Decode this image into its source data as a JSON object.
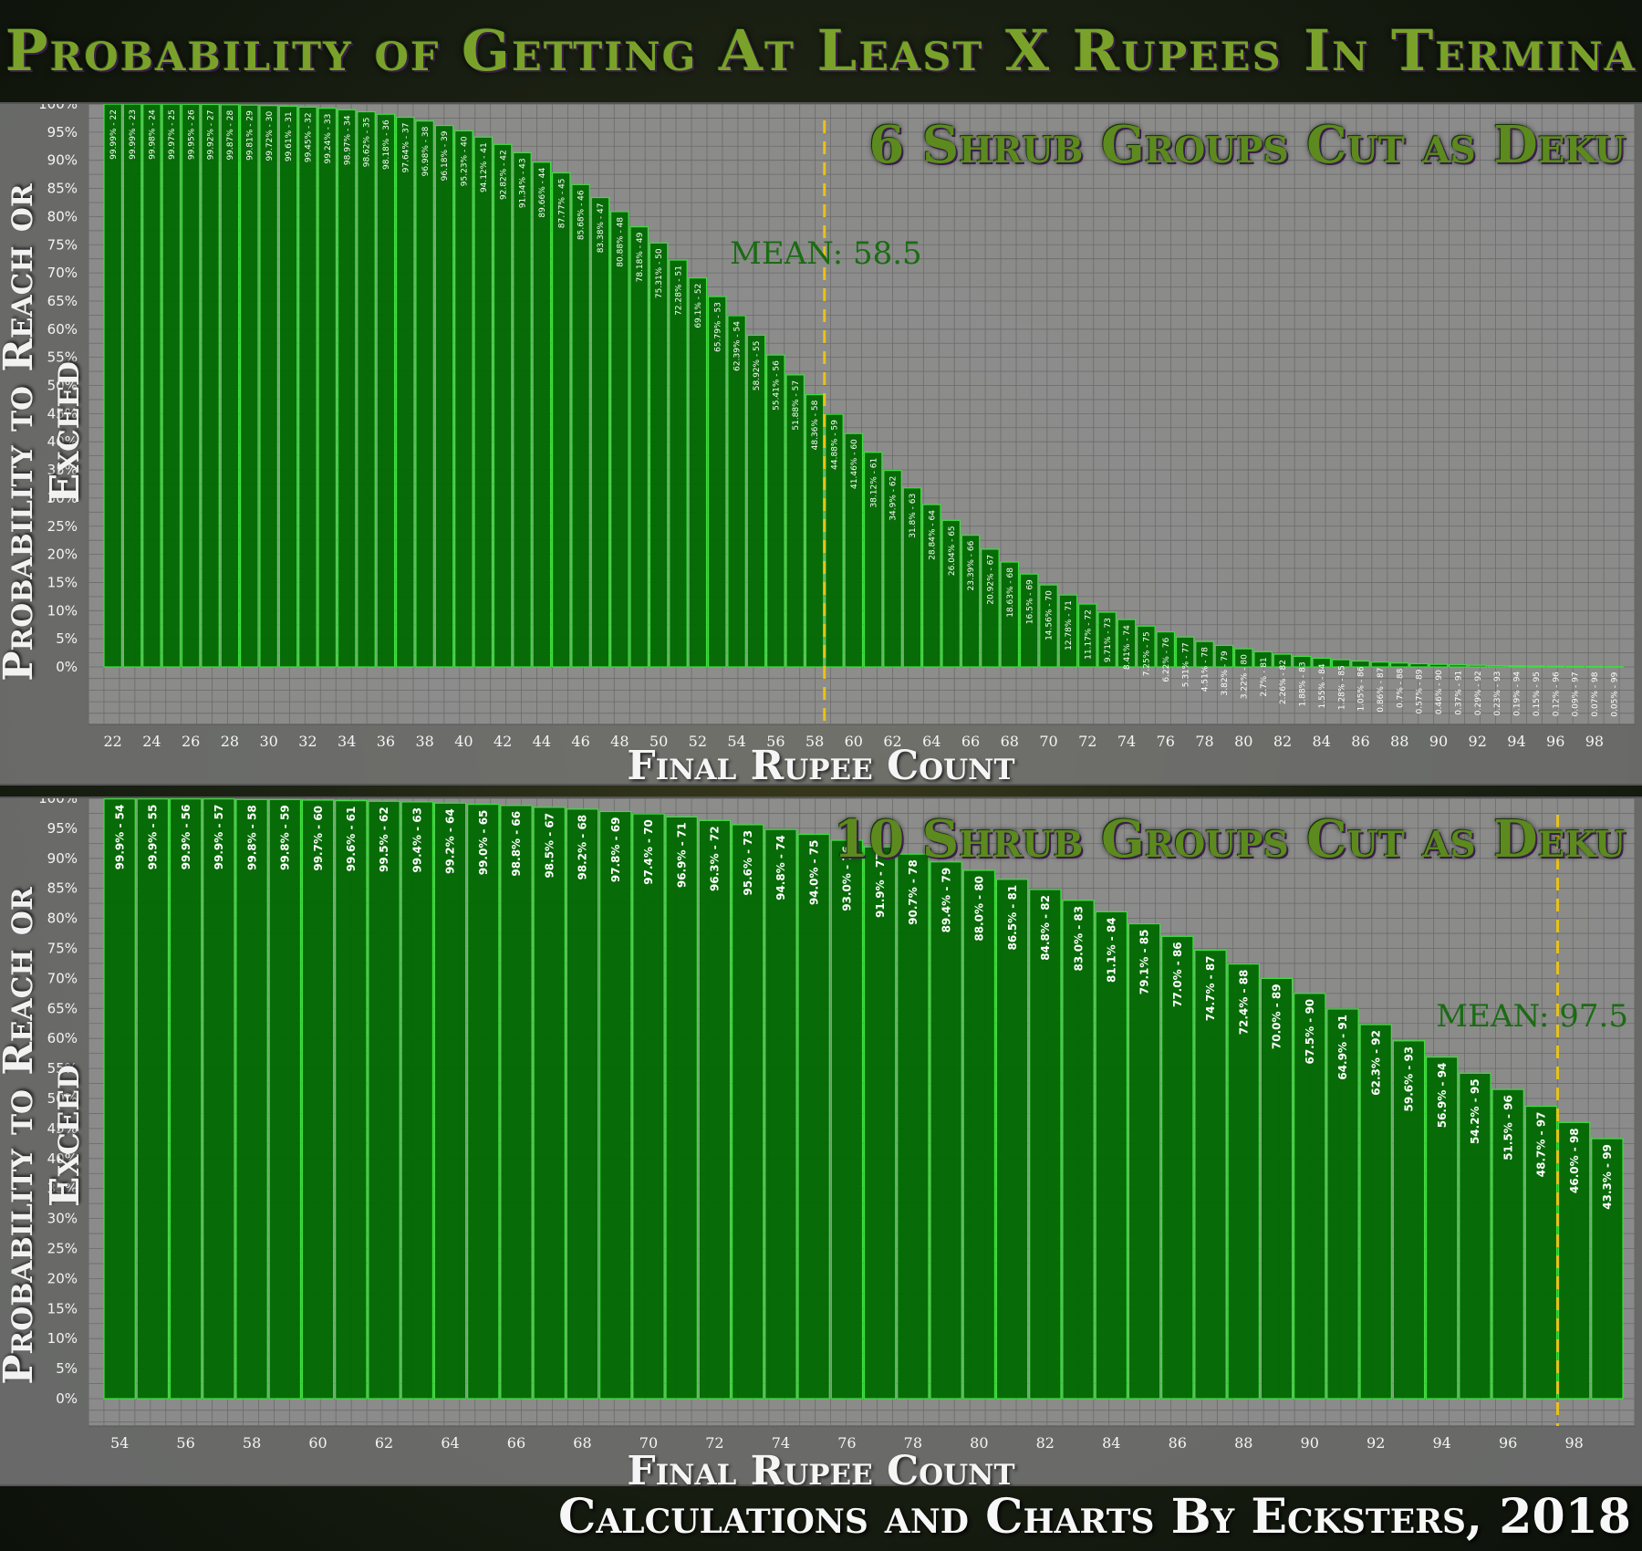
{
  "title": "Probability of Getting At Least X Rupees In Termina",
  "credit": "Calculations and Charts By Ecksters, 2018",
  "chart_data": [
    {
      "type": "bar",
      "title": "6 Shrub Groups Cut as Deku",
      "xlabel": "Final Rupee Count",
      "ylabel": "Probability to Reach or Exceed",
      "ylim": [
        0,
        100
      ],
      "y_ticks": [
        "0%",
        "5%",
        "10%",
        "15%",
        "20%",
        "25%",
        "30%",
        "35%",
        "40%",
        "45%",
        "50%",
        "55%",
        "60%",
        "65%",
        "70%",
        "75%",
        "80%",
        "85%",
        "90%",
        "95%",
        "100%"
      ],
      "x_ticks": [
        "22",
        "24",
        "26",
        "28",
        "30",
        "32",
        "34",
        "36",
        "38",
        "40",
        "42",
        "44",
        "46",
        "48",
        "50",
        "52",
        "54",
        "56",
        "58",
        "60",
        "62",
        "64",
        "66",
        "68",
        "70",
        "72",
        "74",
        "76",
        "78",
        "80",
        "82",
        "84",
        "86",
        "88",
        "90",
        "92",
        "94",
        "96",
        "98"
      ],
      "mean": 58.5,
      "mean_label": "MEAN: 58.5",
      "grid": true,
      "categories": [
        22,
        23,
        24,
        25,
        26,
        27,
        28,
        29,
        30,
        31,
        32,
        33,
        34,
        35,
        36,
        37,
        38,
        39,
        40,
        41,
        42,
        43,
        44,
        45,
        46,
        47,
        48,
        49,
        50,
        51,
        52,
        53,
        54,
        55,
        56,
        57,
        58,
        59,
        60,
        61,
        62,
        63,
        64,
        65,
        66,
        67,
        68,
        69,
        70,
        71,
        72,
        73,
        74,
        75,
        76,
        77,
        78,
        79,
        80,
        81,
        82,
        83,
        84,
        85,
        86,
        87,
        88,
        89,
        90,
        91,
        92,
        93,
        94,
        95,
        96,
        97,
        98,
        99
      ],
      "values": [
        99.99,
        99.99,
        99.98,
        99.97,
        99.95,
        99.92,
        99.87,
        99.81,
        99.72,
        99.61,
        99.45,
        99.24,
        98.97,
        98.62,
        98.18,
        97.64,
        96.98,
        96.18,
        95.23,
        94.12,
        92.82,
        91.34,
        89.66,
        87.77,
        85.68,
        83.38,
        80.88,
        78.18,
        75.31,
        72.28,
        69.1,
        65.79,
        62.39,
        58.92,
        55.41,
        51.88,
        48.36,
        44.88,
        41.46,
        38.12,
        34.9,
        31.8,
        28.84,
        26.04,
        23.39,
        20.92,
        18.63,
        16.5,
        14.56,
        12.78,
        11.17,
        9.71,
        8.41,
        7.25,
        6.22,
        5.31,
        4.51,
        3.82,
        3.22,
        2.7,
        2.26,
        1.88,
        1.55,
        1.28,
        1.05,
        0.86,
        0.7,
        0.57,
        0.46,
        0.37,
        0.29,
        0.23,
        0.19,
        0.15,
        0.12,
        0.09,
        0.07,
        0.05
      ],
      "labels": [
        "99.99% - 22",
        "99.99% - 23",
        "99.98% - 24",
        "99.97% - 25",
        "99.95% - 26",
        "99.92% - 27",
        "99.87% - 28",
        "99.81% - 29",
        "99.72% - 30",
        "99.61% - 31",
        "99.45% - 32",
        "99.24% - 33",
        "98.97% - 34",
        "98.62% - 35",
        "98.18% - 36",
        "97.64% - 37",
        "96.98% - 38",
        "96.18% - 39",
        "95.23% - 40",
        "94.12% - 41",
        "92.82% - 42",
        "91.34% - 43",
        "89.66% - 44",
        "87.77% - 45",
        "85.68% - 46",
        "83.38% - 47",
        "80.88% - 48",
        "78.18% - 49",
        "75.31% - 50",
        "72.28% - 51",
        "69.1% - 52",
        "65.79% - 53",
        "62.39% - 54",
        "58.92% - 55",
        "55.41% - 56",
        "51.88% - 57",
        "48.36% - 58",
        "44.88% - 59",
        "41.46% - 60",
        "38.12% - 61",
        "34.9% - 62",
        "31.8% - 63",
        "28.84% - 64",
        "26.04% - 65",
        "23.39% - 66",
        "20.92% - 67",
        "18.63% - 68",
        "16.5% - 69",
        "14.56% - 70",
        "12.78% - 71",
        "11.17% - 72",
        "9.71% - 73",
        "8.41% - 74",
        "7.25% - 75",
        "6.22% - 76",
        "5.31% - 77",
        "4.51% - 78",
        "3.82% - 79",
        "3.22% - 80",
        "2.7% - 81",
        "2.26% - 82",
        "1.88% - 83",
        "1.55% - 84",
        "1.28% - 85",
        "1.05% - 86",
        "0.86% - 87",
        "0.7% - 88",
        "0.57% - 89",
        "0.46% - 90",
        "0.37% - 91",
        "0.29% - 92",
        "0.23% - 93",
        "0.19% - 94",
        "0.15% - 95",
        "0.12% - 96",
        "0.09% - 97",
        "0.07% - 98",
        "0.05% - 99"
      ]
    },
    {
      "type": "bar",
      "title": "10 Shrub Groups Cut as Deku",
      "xlabel": "Final Rupee Count",
      "ylabel": "Probability to Reach or Exceed",
      "ylim": [
        0,
        100
      ],
      "y_ticks": [
        "0%",
        "5%",
        "10%",
        "15%",
        "20%",
        "25%",
        "30%",
        "35%",
        "40%",
        "45%",
        "50%",
        "55%",
        "60%",
        "65%",
        "70%",
        "75%",
        "80%",
        "85%",
        "90%",
        "95%",
        "100%"
      ],
      "x_ticks": [
        "54",
        "56",
        "58",
        "60",
        "62",
        "64",
        "66",
        "68",
        "70",
        "72",
        "74",
        "76",
        "78",
        "80",
        "82",
        "84",
        "86",
        "88",
        "90",
        "92",
        "94",
        "96",
        "98"
      ],
      "mean": 97.5,
      "mean_label": "MEAN: 97.5",
      "grid": true,
      "categories": [
        54,
        55,
        56,
        57,
        58,
        59,
        60,
        61,
        62,
        63,
        64,
        65,
        66,
        67,
        68,
        69,
        70,
        71,
        72,
        73,
        74,
        75,
        76,
        77,
        78,
        79,
        80,
        81,
        82,
        83,
        84,
        85,
        86,
        87,
        88,
        89,
        90,
        91,
        92,
        93,
        94,
        95,
        96,
        97,
        98,
        99
      ],
      "values": [
        99.9,
        99.9,
        99.9,
        99.9,
        99.8,
        99.8,
        99.7,
        99.6,
        99.5,
        99.4,
        99.2,
        99.0,
        98.8,
        98.5,
        98.2,
        97.8,
        97.4,
        96.9,
        96.3,
        95.6,
        94.8,
        94.0,
        93.0,
        91.9,
        90.7,
        89.4,
        88.0,
        86.5,
        84.8,
        83.0,
        81.1,
        79.1,
        77.0,
        74.7,
        72.4,
        70.0,
        67.5,
        64.9,
        62.3,
        59.6,
        56.9,
        54.2,
        51.5,
        48.7,
        46.0,
        43.3
      ],
      "labels": [
        "99.9% - 54",
        "99.9% - 55",
        "99.9% - 56",
        "99.9% - 57",
        "99.8% - 58",
        "99.8% - 59",
        "99.7% - 60",
        "99.6% - 61",
        "99.5% - 62",
        "99.4% - 63",
        "99.2% - 64",
        "99.0% - 65",
        "98.8% - 66",
        "98.5% - 67",
        "98.2% - 68",
        "97.8% - 69",
        "97.4% - 70",
        "96.9% - 71",
        "96.3% - 72",
        "95.6% - 73",
        "94.8% - 74",
        "94.0% - 75",
        "93.0% - 76",
        "91.9% - 77",
        "90.7% - 78",
        "89.4% - 79",
        "88.0% - 80",
        "86.5% - 81",
        "84.8% - 82",
        "83.0% - 83",
        "81.1% - 84",
        "79.1% - 85",
        "77.0% - 86",
        "74.7% - 87",
        "72.4% - 88",
        "70.0% - 89",
        "67.5% - 90",
        "64.9% - 91",
        "62.3% - 92",
        "59.6% - 93",
        "56.9% - 94",
        "54.2% - 95",
        "51.5% - 96",
        "48.7% - 97",
        "46.0% - 98",
        "43.3% - 99"
      ]
    }
  ]
}
